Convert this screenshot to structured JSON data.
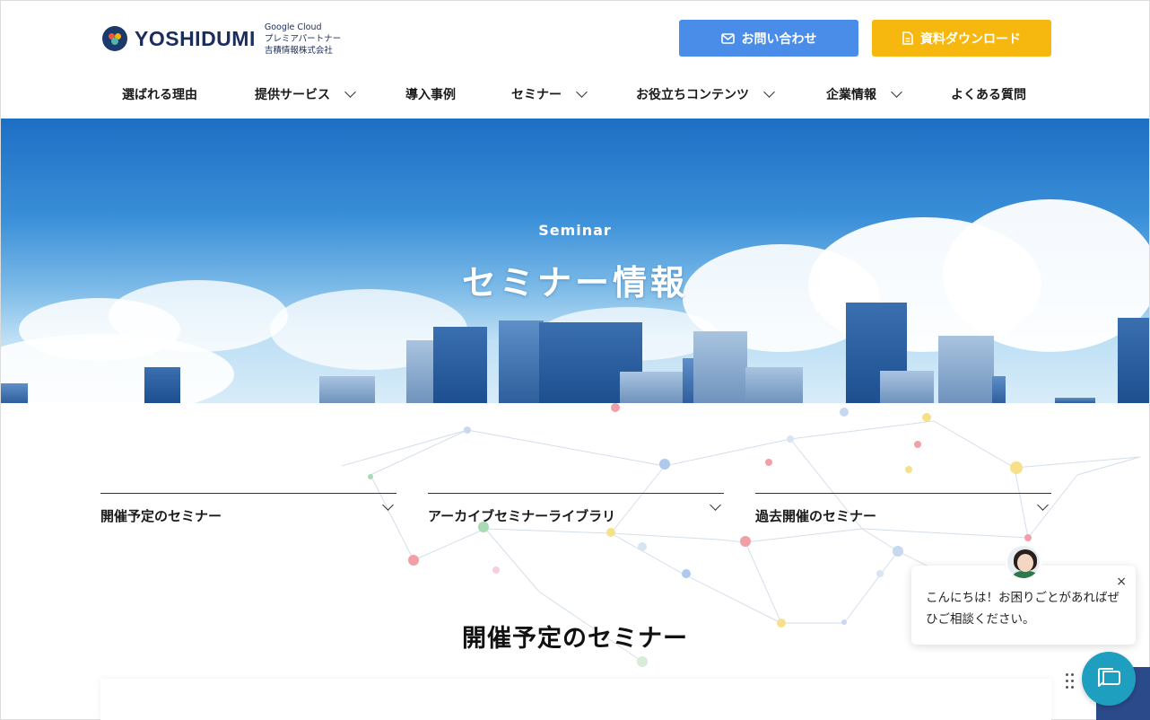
{
  "header": {
    "logo_text": "YOSHIDUMI",
    "logo_sub": [
      "Google Cloud",
      "プレミアパートナー",
      "吉積情報株式会社"
    ],
    "contact_label": "お問い合わせ",
    "download_label": "資料ダウンロード",
    "contact_color": "#4a8de8",
    "download_color": "#f6b70e"
  },
  "nav": {
    "items": [
      {
        "label": "選ばれる理由",
        "has_dropdown": false
      },
      {
        "label": "提供サービス",
        "has_dropdown": true
      },
      {
        "label": "導入事例",
        "has_dropdown": false
      },
      {
        "label": "セミナー",
        "has_dropdown": true
      },
      {
        "label": "お役立ちコンテンツ",
        "has_dropdown": true
      },
      {
        "label": "企業情報",
        "has_dropdown": true
      },
      {
        "label": "よくある質問",
        "has_dropdown": false
      }
    ]
  },
  "hero": {
    "subtitle": "Seminar",
    "title": "セミナー情報"
  },
  "tabs": [
    {
      "label": "開催予定のセミナー"
    },
    {
      "label": "アーカイブセミナーライブラリ"
    },
    {
      "label": "過去開催のセミナー"
    }
  ],
  "section": {
    "title": "開催予定のセミナー"
  },
  "chat": {
    "message": "こんにちは！お困りごとがあればぜひご相談ください。",
    "close_icon": "×"
  }
}
